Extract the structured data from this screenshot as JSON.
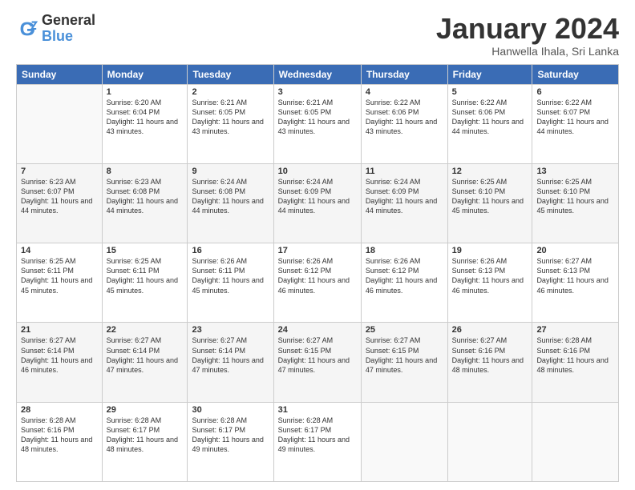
{
  "logo": {
    "line1": "General",
    "line2": "Blue"
  },
  "title": "January 2024",
  "subtitle": "Hanwella Ihala, Sri Lanka",
  "header_days": [
    "Sunday",
    "Monday",
    "Tuesday",
    "Wednesday",
    "Thursday",
    "Friday",
    "Saturday"
  ],
  "weeks": [
    [
      {
        "day": "",
        "sunrise": "",
        "sunset": "",
        "daylight": ""
      },
      {
        "day": "1",
        "sunrise": "Sunrise: 6:20 AM",
        "sunset": "Sunset: 6:04 PM",
        "daylight": "Daylight: 11 hours and 43 minutes."
      },
      {
        "day": "2",
        "sunrise": "Sunrise: 6:21 AM",
        "sunset": "Sunset: 6:05 PM",
        "daylight": "Daylight: 11 hours and 43 minutes."
      },
      {
        "day": "3",
        "sunrise": "Sunrise: 6:21 AM",
        "sunset": "Sunset: 6:05 PM",
        "daylight": "Daylight: 11 hours and 43 minutes."
      },
      {
        "day": "4",
        "sunrise": "Sunrise: 6:22 AM",
        "sunset": "Sunset: 6:06 PM",
        "daylight": "Daylight: 11 hours and 43 minutes."
      },
      {
        "day": "5",
        "sunrise": "Sunrise: 6:22 AM",
        "sunset": "Sunset: 6:06 PM",
        "daylight": "Daylight: 11 hours and 44 minutes."
      },
      {
        "day": "6",
        "sunrise": "Sunrise: 6:22 AM",
        "sunset": "Sunset: 6:07 PM",
        "daylight": "Daylight: 11 hours and 44 minutes."
      }
    ],
    [
      {
        "day": "7",
        "sunrise": "Sunrise: 6:23 AM",
        "sunset": "Sunset: 6:07 PM",
        "daylight": "Daylight: 11 hours and 44 minutes."
      },
      {
        "day": "8",
        "sunrise": "Sunrise: 6:23 AM",
        "sunset": "Sunset: 6:08 PM",
        "daylight": "Daylight: 11 hours and 44 minutes."
      },
      {
        "day": "9",
        "sunrise": "Sunrise: 6:24 AM",
        "sunset": "Sunset: 6:08 PM",
        "daylight": "Daylight: 11 hours and 44 minutes."
      },
      {
        "day": "10",
        "sunrise": "Sunrise: 6:24 AM",
        "sunset": "Sunset: 6:09 PM",
        "daylight": "Daylight: 11 hours and 44 minutes."
      },
      {
        "day": "11",
        "sunrise": "Sunrise: 6:24 AM",
        "sunset": "Sunset: 6:09 PM",
        "daylight": "Daylight: 11 hours and 44 minutes."
      },
      {
        "day": "12",
        "sunrise": "Sunrise: 6:25 AM",
        "sunset": "Sunset: 6:10 PM",
        "daylight": "Daylight: 11 hours and 45 minutes."
      },
      {
        "day": "13",
        "sunrise": "Sunrise: 6:25 AM",
        "sunset": "Sunset: 6:10 PM",
        "daylight": "Daylight: 11 hours and 45 minutes."
      }
    ],
    [
      {
        "day": "14",
        "sunrise": "Sunrise: 6:25 AM",
        "sunset": "Sunset: 6:11 PM",
        "daylight": "Daylight: 11 hours and 45 minutes."
      },
      {
        "day": "15",
        "sunrise": "Sunrise: 6:25 AM",
        "sunset": "Sunset: 6:11 PM",
        "daylight": "Daylight: 11 hours and 45 minutes."
      },
      {
        "day": "16",
        "sunrise": "Sunrise: 6:26 AM",
        "sunset": "Sunset: 6:11 PM",
        "daylight": "Daylight: 11 hours and 45 minutes."
      },
      {
        "day": "17",
        "sunrise": "Sunrise: 6:26 AM",
        "sunset": "Sunset: 6:12 PM",
        "daylight": "Daylight: 11 hours and 46 minutes."
      },
      {
        "day": "18",
        "sunrise": "Sunrise: 6:26 AM",
        "sunset": "Sunset: 6:12 PM",
        "daylight": "Daylight: 11 hours and 46 minutes."
      },
      {
        "day": "19",
        "sunrise": "Sunrise: 6:26 AM",
        "sunset": "Sunset: 6:13 PM",
        "daylight": "Daylight: 11 hours and 46 minutes."
      },
      {
        "day": "20",
        "sunrise": "Sunrise: 6:27 AM",
        "sunset": "Sunset: 6:13 PM",
        "daylight": "Daylight: 11 hours and 46 minutes."
      }
    ],
    [
      {
        "day": "21",
        "sunrise": "Sunrise: 6:27 AM",
        "sunset": "Sunset: 6:14 PM",
        "daylight": "Daylight: 11 hours and 46 minutes."
      },
      {
        "day": "22",
        "sunrise": "Sunrise: 6:27 AM",
        "sunset": "Sunset: 6:14 PM",
        "daylight": "Daylight: 11 hours and 47 minutes."
      },
      {
        "day": "23",
        "sunrise": "Sunrise: 6:27 AM",
        "sunset": "Sunset: 6:14 PM",
        "daylight": "Daylight: 11 hours and 47 minutes."
      },
      {
        "day": "24",
        "sunrise": "Sunrise: 6:27 AM",
        "sunset": "Sunset: 6:15 PM",
        "daylight": "Daylight: 11 hours and 47 minutes."
      },
      {
        "day": "25",
        "sunrise": "Sunrise: 6:27 AM",
        "sunset": "Sunset: 6:15 PM",
        "daylight": "Daylight: 11 hours and 47 minutes."
      },
      {
        "day": "26",
        "sunrise": "Sunrise: 6:27 AM",
        "sunset": "Sunset: 6:16 PM",
        "daylight": "Daylight: 11 hours and 48 minutes."
      },
      {
        "day": "27",
        "sunrise": "Sunrise: 6:28 AM",
        "sunset": "Sunset: 6:16 PM",
        "daylight": "Daylight: 11 hours and 48 minutes."
      }
    ],
    [
      {
        "day": "28",
        "sunrise": "Sunrise: 6:28 AM",
        "sunset": "Sunset: 6:16 PM",
        "daylight": "Daylight: 11 hours and 48 minutes."
      },
      {
        "day": "29",
        "sunrise": "Sunrise: 6:28 AM",
        "sunset": "Sunset: 6:17 PM",
        "daylight": "Daylight: 11 hours and 48 minutes."
      },
      {
        "day": "30",
        "sunrise": "Sunrise: 6:28 AM",
        "sunset": "Sunset: 6:17 PM",
        "daylight": "Daylight: 11 hours and 49 minutes."
      },
      {
        "day": "31",
        "sunrise": "Sunrise: 6:28 AM",
        "sunset": "Sunset: 6:17 PM",
        "daylight": "Daylight: 11 hours and 49 minutes."
      },
      {
        "day": "",
        "sunrise": "",
        "sunset": "",
        "daylight": ""
      },
      {
        "day": "",
        "sunrise": "",
        "sunset": "",
        "daylight": ""
      },
      {
        "day": "",
        "sunrise": "",
        "sunset": "",
        "daylight": ""
      }
    ]
  ]
}
